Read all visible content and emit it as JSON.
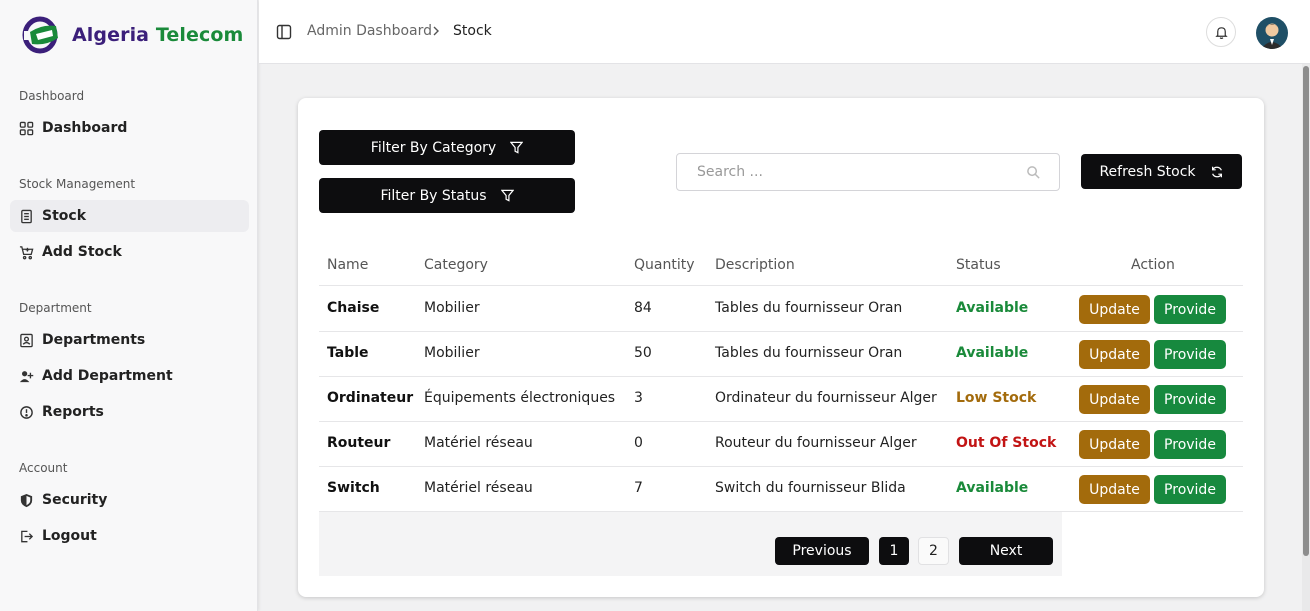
{
  "brand": {
    "name_part1": "Algeria",
    "name_part2": "Telecom"
  },
  "sidebar": {
    "groups": [
      {
        "label": "Dashboard"
      },
      {
        "label": "Stock Management"
      },
      {
        "label": "Department"
      },
      {
        "label": "Account"
      }
    ],
    "items": [
      {
        "label": "Dashboard",
        "icon": "grid-icon"
      },
      {
        "label": "Stock",
        "icon": "document-icon",
        "active": true
      },
      {
        "label": "Add Stock",
        "icon": "cart-plus-icon"
      },
      {
        "label": "Departments",
        "icon": "id-card-icon"
      },
      {
        "label": "Add Department",
        "icon": "user-plus-icon"
      },
      {
        "label": "Reports",
        "icon": "alert-circle-icon"
      },
      {
        "label": "Security",
        "icon": "shield-icon"
      },
      {
        "label": "Logout",
        "icon": "logout-icon"
      }
    ]
  },
  "header": {
    "breadcrumb": [
      "Admin Dashboard",
      "Stock"
    ]
  },
  "toolbar": {
    "filter_category": "Filter By Category",
    "filter_status": "Filter By Status",
    "search_placeholder": "Search ...",
    "refresh": "Refresh Stock"
  },
  "table": {
    "columns": [
      "Name",
      "Category",
      "Quantity",
      "Description",
      "Status",
      "Action"
    ],
    "rows": [
      {
        "name": "Chaise",
        "category": "Mobilier",
        "quantity": "84",
        "description": "Tables du fournisseur Oran",
        "status": "Available"
      },
      {
        "name": "Table",
        "category": "Mobilier",
        "quantity": "50",
        "description": "Tables du fournisseur Oran",
        "status": "Available"
      },
      {
        "name": "Ordinateur",
        "category": "Équipements électroniques",
        "quantity": "3",
        "description": "Ordinateur du fournisseur Alger",
        "status": "Low Stock"
      },
      {
        "name": "Routeur",
        "category": "Matériel réseau",
        "quantity": "0",
        "description": "Routeur du fournisseur Alger",
        "status": "Out Of Stock"
      },
      {
        "name": "Switch",
        "category": "Matériel réseau",
        "quantity": "7",
        "description": "Switch du fournisseur Blida",
        "status": "Available"
      }
    ],
    "update_label": "Update",
    "provide_label": "Provide"
  },
  "status_colors": {
    "Available": "#1a8a3a",
    "Low Stock": "#a36b0c",
    "Out Of Stock": "#c21414"
  },
  "pagination": {
    "previous": "Previous",
    "pages": [
      "1",
      "2"
    ],
    "current": "1",
    "next": "Next"
  }
}
